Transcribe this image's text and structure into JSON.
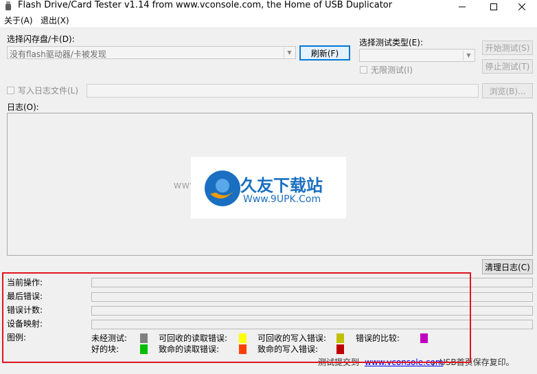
{
  "window": {
    "title": "Flash Drive/Card Tester v1.14 from www.vconsole.com, the Home of USB Duplicator"
  },
  "menu": [
    {
      "label": "关于(A)"
    },
    {
      "label": "退出(X)"
    }
  ],
  "drive": {
    "label": "选择闪存盘/卡(D):",
    "selected": "没有flash驱动器/卡被发现",
    "refresh_button": "刷新(F)"
  },
  "test_type": {
    "label": "选择测试类型(E):",
    "selected": "",
    "infinite_label": "无限测试(I)",
    "start_button": "开始测试(S)",
    "stop_button": "停止测试(T)"
  },
  "logfile": {
    "checkbox_label": "写入日志文件(L)",
    "path": "",
    "browse_button": "浏览(B)..."
  },
  "log": {
    "label": "日志(O):",
    "clear_button": "清理日志(C)"
  },
  "watermark": {
    "left_text": "WWW.9UPK.COM",
    "brand": "久友下载站",
    "url": "Www.9UPK.Com"
  },
  "status": {
    "current_op_label": "当前操作:",
    "last_error_label": "最后错误:",
    "error_count_label": "错误计数:",
    "device_map_label": "设备映射:",
    "legend_label": "图例:"
  },
  "legend": {
    "row1": [
      {
        "label": "未经测试:",
        "color": "#808080"
      },
      {
        "label": "可回收的读取错误:",
        "color": "#ffff00"
      },
      {
        "label": "可回收的写入错误:",
        "color": "#c0c000"
      },
      {
        "label": "错误的比较:",
        "color": "#c000c0"
      }
    ],
    "row2": [
      {
        "label": "好的块:",
        "color": "#00c000"
      },
      {
        "label": "致命的读取错误:",
        "color": "#ff4000"
      },
      {
        "label": "致命的写入错误:",
        "color": "#c00000"
      }
    ]
  },
  "footer": {
    "prefix": "测试提交到",
    "link": "www.vconsole.com",
    "suffix": "，USB首页保存复印。"
  },
  "colors": {
    "highlight": "#e0141d",
    "primary_border": "#0078d7",
    "brand_blue": "#1a6fc0",
    "brand_orange": "#f39a00"
  }
}
